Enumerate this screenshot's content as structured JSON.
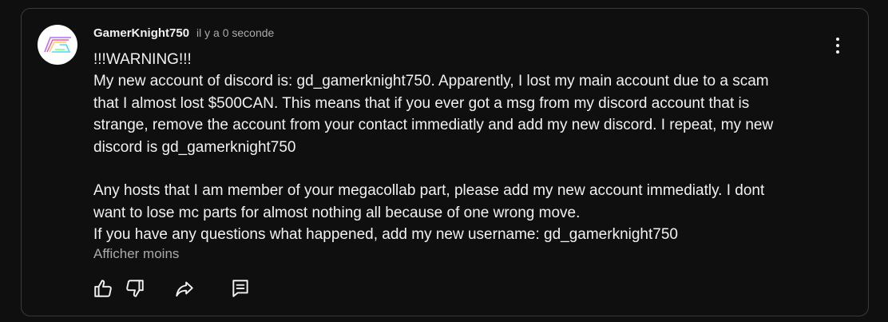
{
  "comment": {
    "author": "GamerKnight750",
    "timestamp": "il y a 0 seconde",
    "avatar_icon": "gk-logo-avatar",
    "lines": [
      "!!!WARNING!!!",
      "My new account of discord is: gd_gamerknight750. Apparently, I lost my main account due to a scam",
      "that I almost lost $500CAN. This means that if you ever got a msg from my discord account that is",
      "strange, remove the account from your contact immediatly and add my new discord. I repeat, my new",
      "discord is gd_gamerknight750",
      "",
      "Any hosts that I am member of your megacollab part, please add my new account immediatly. I dont",
      "want to lose mc parts for almost nothing all because of one wrong move.",
      "If you have any questions what happened, add my new username: gd_gamerknight750"
    ],
    "show_less_label": "Afficher moins"
  },
  "actions": {
    "like_icon": "thumbs-up-icon",
    "dislike_icon": "thumbs-down-icon",
    "share_icon": "share-icon",
    "reply_icon": "reply-icon"
  },
  "colors": {
    "background": "#0f0f0f",
    "border": "#3a3a3a",
    "text": "#f1f1f1",
    "muted_text": "#aaaaaa"
  }
}
